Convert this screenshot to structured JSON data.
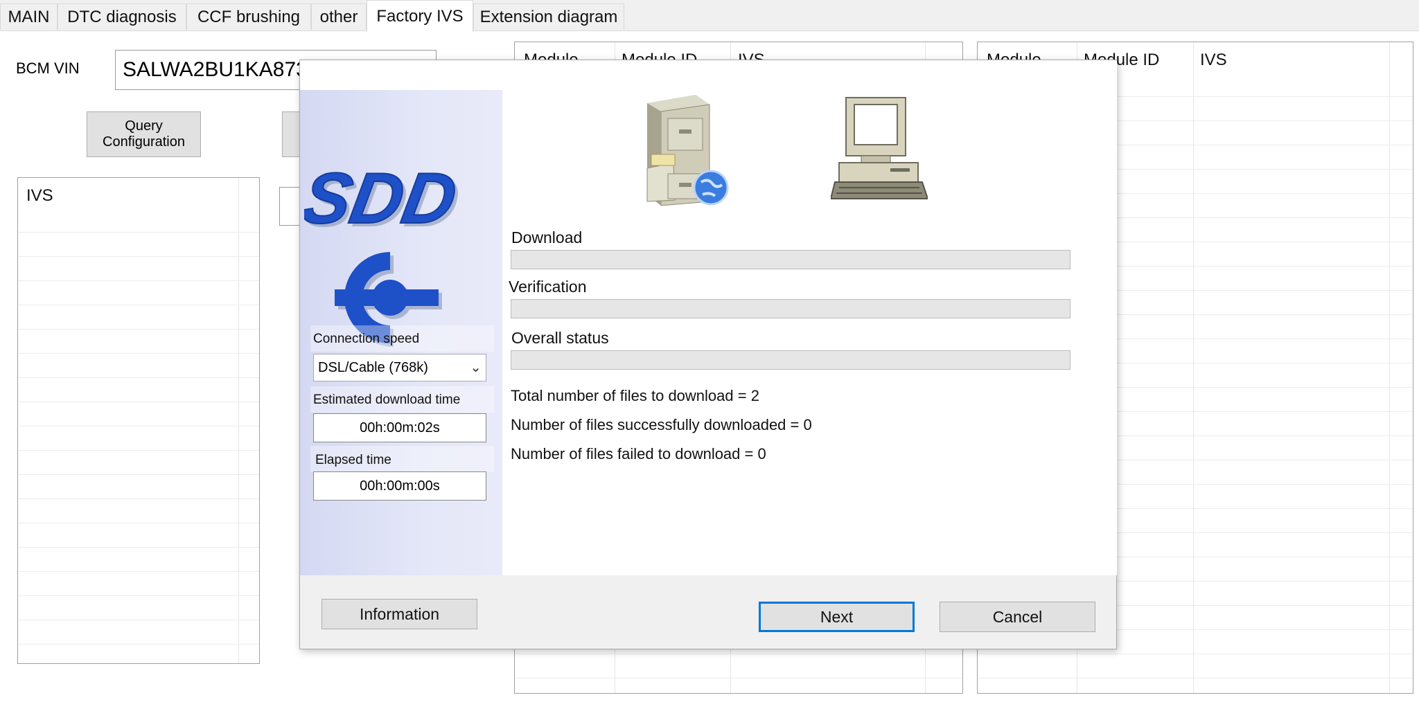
{
  "tabs": [
    {
      "label": "MAIN"
    },
    {
      "label": "DTC diagnosis"
    },
    {
      "label": "CCF brushing"
    },
    {
      "label": "other"
    },
    {
      "label": "Factory IVS",
      "active": true
    },
    {
      "label": "Extension diagram"
    }
  ],
  "form": {
    "vin_label": "BCM VIN",
    "vin_value": "SALWA2BU1KA873",
    "query_button": [
      "Query",
      "Configuration"
    ]
  },
  "ivs_list": {
    "header": "IVS"
  },
  "grid_mid": {
    "columns": [
      "Module",
      "Module ID",
      "IVS"
    ]
  },
  "grid_right": {
    "columns": [
      "Module",
      "Module ID",
      "IVS"
    ]
  },
  "dialog": {
    "logo_text": "SDD",
    "connection_speed_label": "Connection speed",
    "connection_speed_value": "DSL/Cable (768k)",
    "estimated_label": "Estimated download time",
    "estimated_value": "00h:00m:02s",
    "elapsed_label": "Elapsed time",
    "elapsed_value": "00h:00m:00s",
    "download_label": "Download",
    "download_progress": 0,
    "verification_label": "Verification",
    "verification_progress": 0,
    "overall_label": "Overall status",
    "overall_progress": 0,
    "stats": [
      "Total number of files to download = 2",
      "Number of files successfully downloaded = 0",
      "Number of files failed to download = 0"
    ],
    "information_button": "Information",
    "next_button": "Next",
    "cancel_button": "Cancel",
    "icons": [
      "file-cabinet-globe-icon",
      "computer-icon"
    ],
    "colors": {
      "logo_blue": "#1e50c8",
      "progress_fill": "#06b025",
      "focus_border": "#0078d7"
    }
  }
}
